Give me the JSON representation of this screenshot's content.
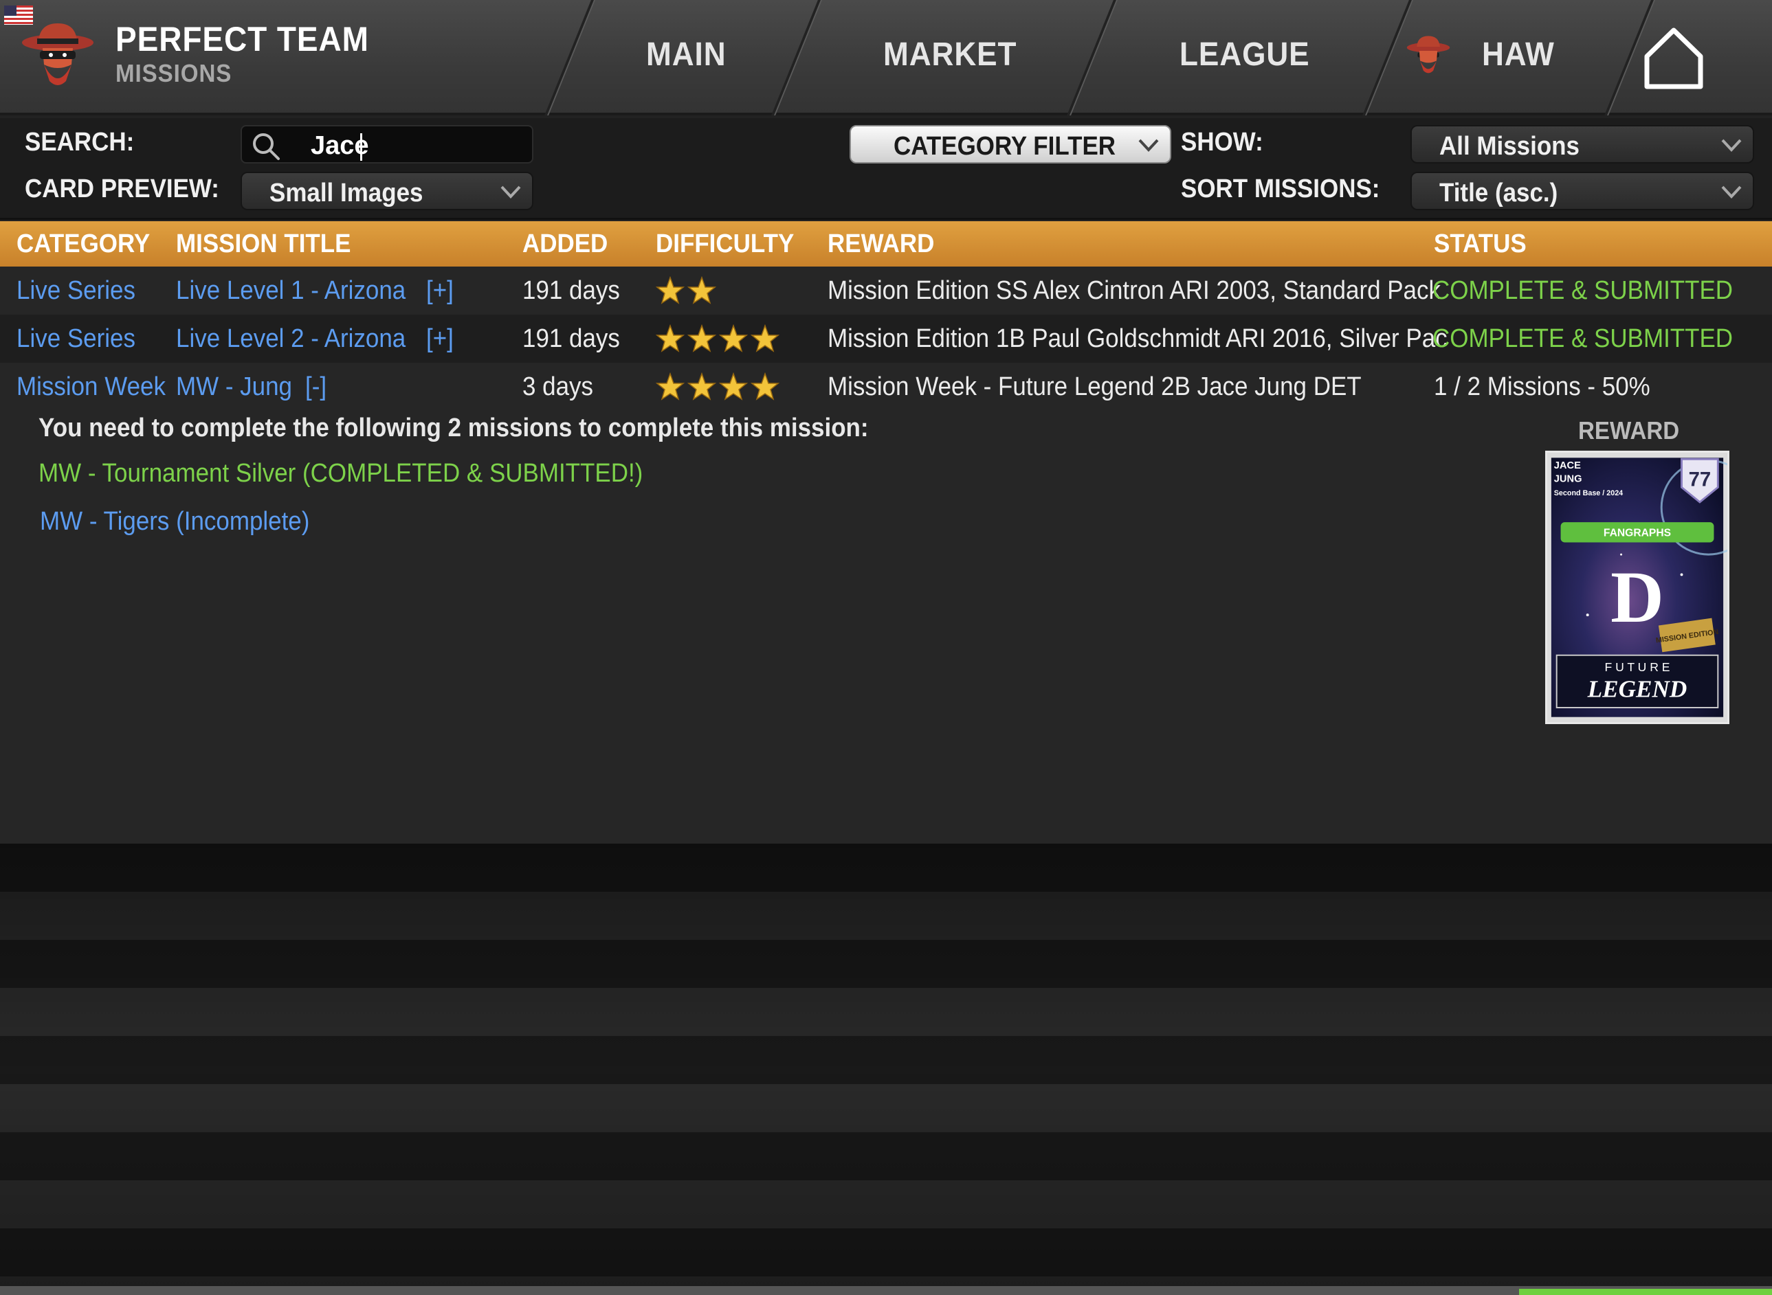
{
  "app": {
    "title": "PERFECT TEAM",
    "subtitle": "MISSIONS"
  },
  "nav": {
    "main": "MAIN",
    "market": "MARKET",
    "league": "LEAGUE",
    "team": "HAW"
  },
  "filters": {
    "search_label": "SEARCH:",
    "search_value": "Jace",
    "card_preview_label": "CARD PREVIEW:",
    "card_preview_value": "Small Images",
    "category_filter": "CATEGORY FILTER",
    "show_label": "SHOW:",
    "show_value": "All Missions",
    "sort_label": "SORT MISSIONS:",
    "sort_value": "Title (asc.)"
  },
  "table": {
    "headers": {
      "category": "CATEGORY",
      "title": "MISSION TITLE",
      "added": "ADDED",
      "difficulty": "DIFFICULTY",
      "reward": "REWARD",
      "status": "STATUS"
    },
    "rows": [
      {
        "category": "Live Series",
        "title": "Live Level 1 - Arizona",
        "toggle": "[+]",
        "added": "191 days",
        "difficulty": 2,
        "reward": "Mission Edition SS Alex Cintron ARI 2003, Standard Pack",
        "status": "COMPLETE & SUBMITTED"
      },
      {
        "category": "Live Series",
        "title": "Live Level 2 - Arizona",
        "toggle": "[+]",
        "added": "191 days",
        "difficulty": 4,
        "reward": "Mission Edition 1B Paul Goldschmidt ARI 2016, Silver Pac",
        "status": "COMPLETE & SUBMITTED"
      },
      {
        "category": "Mission Week",
        "title": "MW - Jung",
        "toggle": "[-]",
        "added": "3 days",
        "difficulty": 4,
        "reward": "Mission Week - Future Legend 2B Jace Jung DET",
        "status": "1 / 2 Missions - 50%"
      }
    ]
  },
  "detail": {
    "intro": "You need to complete the following 2 missions to complete this mission:",
    "submissions": [
      "MW - Tournament Silver (COMPLETED & SUBMITTED!)",
      "MW - Tigers (Incomplete)"
    ],
    "reward_label": "REWARD",
    "card": {
      "first_name": "JACE",
      "last_name": "JUNG",
      "position_year": "Second Base / 2024",
      "rating": "77",
      "sponsor": "FANGRAPHS",
      "team_letter": "D",
      "badge": "MISSION EDITION",
      "series_top": "F U T U R E",
      "series_bottom": "LEGEND"
    }
  },
  "colors": {
    "accent_orange": "#d8922f",
    "link_blue": "#5c9cf0",
    "complete_green": "#7dd24a",
    "star_gold": "#f3c43a"
  }
}
